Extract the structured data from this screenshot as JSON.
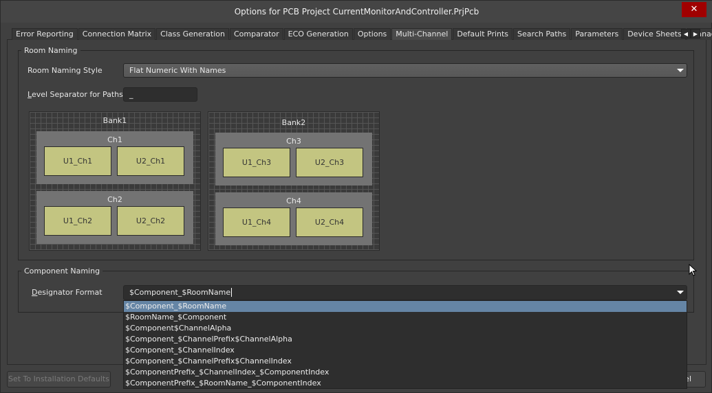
{
  "window": {
    "title": "Options for PCB Project CurrentMonitorAndController.PrjPcb",
    "close_glyph": "✕"
  },
  "tabs": [
    {
      "label": "Error Reporting",
      "active": false
    },
    {
      "label": "Connection Matrix",
      "active": false
    },
    {
      "label": "Class Generation",
      "active": false
    },
    {
      "label": "Comparator",
      "active": false
    },
    {
      "label": "ECO Generation",
      "active": false
    },
    {
      "label": "Options",
      "active": false
    },
    {
      "label": "Multi-Channel",
      "active": true
    },
    {
      "label": "Default Prints",
      "active": false
    },
    {
      "label": "Search Paths",
      "active": false
    },
    {
      "label": "Parameters",
      "active": false
    },
    {
      "label": "Device Sheets",
      "active": false
    },
    {
      "label": "Managed",
      "active": false
    }
  ],
  "tab_nav": {
    "left": "◀",
    "right": "▶"
  },
  "room_naming": {
    "group_label": "Room Naming",
    "style_label": "Room Naming Style",
    "style_value": "Flat Numeric With Names",
    "separator_label": "Level Separator for Paths",
    "separator_value": "_",
    "banks": [
      {
        "name": "Bank1",
        "channels": [
          {
            "name": "Ch1",
            "components": [
              "U1_Ch1",
              "U2_Ch1"
            ]
          },
          {
            "name": "Ch2",
            "components": [
              "U1_Ch2",
              "U2_Ch2"
            ]
          }
        ]
      },
      {
        "name": "Bank2",
        "channels": [
          {
            "name": "Ch3",
            "components": [
              "U1_Ch3",
              "U2_Ch3"
            ]
          },
          {
            "name": "Ch4",
            "components": [
              "U1_Ch4",
              "U2_Ch4"
            ]
          }
        ]
      }
    ]
  },
  "component_naming": {
    "group_label": "Component Naming",
    "designator_label": "Designator Format",
    "designator_value": "$Component_$RoomName",
    "options": [
      "$Component_$RoomName",
      "$RoomName_$Component",
      "$Component$ChannelAlpha",
      "$Component_$ChannelPrefix$ChannelAlpha",
      "$Component_$ChannelIndex",
      "$Component_$ChannelPrefix$ChannelIndex",
      "$ComponentPrefix_$ChannelIndex_$ComponentIndex",
      "$ComponentPrefix_$RoomName_$ComponentIndex"
    ],
    "selected_index": 0
  },
  "footer": {
    "defaults_button": "Set To Installation Defaults",
    "cancel_button_visible": "el"
  },
  "colors": {
    "highlight": "#6585a5",
    "component_fill": "#c3c581",
    "close_button": "#a00000"
  }
}
